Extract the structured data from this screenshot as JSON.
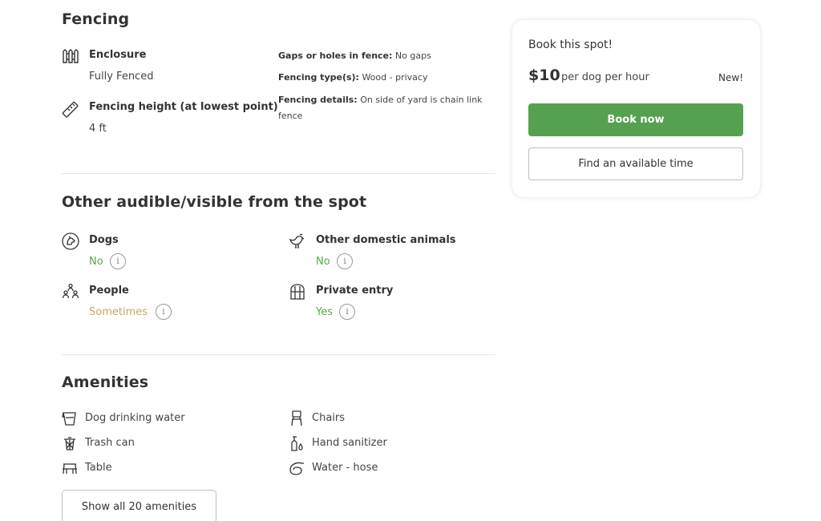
{
  "fencing": {
    "title": "Fencing",
    "enclosure": {
      "label": "Enclosure",
      "value": "Fully Fenced",
      "icon": "fence-icon"
    },
    "height": {
      "label": "Fencing height (at lowest point)",
      "value": "4 ft",
      "icon": "ruler-icon"
    },
    "details": [
      {
        "key": "Gaps or holes in fence:",
        "value": "No gaps"
      },
      {
        "key": "Fencing type(s):",
        "value": "Wood - privacy"
      },
      {
        "key": "Fencing details:",
        "value": "On side of yard is chain link fence"
      }
    ]
  },
  "audible": {
    "title": "Other audible/visible from the spot",
    "items": [
      {
        "label": "Dogs",
        "value": "No",
        "status": "green",
        "icon": "dog-icon"
      },
      {
        "label": "Other domestic animals",
        "value": "No",
        "status": "green",
        "icon": "rooster-icon"
      },
      {
        "label": "People",
        "value": "Sometimes",
        "status": "tan",
        "icon": "people-icon"
      },
      {
        "label": "Private entry",
        "value": "Yes",
        "status": "green",
        "icon": "gate-icon"
      }
    ]
  },
  "amenities": {
    "title": "Amenities",
    "items": [
      {
        "label": "Dog drinking water",
        "icon": "water-bowl-icon"
      },
      {
        "label": "Chairs",
        "icon": "chair-icon"
      },
      {
        "label": "Trash can",
        "icon": "trash-can-icon"
      },
      {
        "label": "Hand sanitizer",
        "icon": "sanitizer-icon"
      },
      {
        "label": "Table",
        "icon": "table-icon"
      },
      {
        "label": "Water - hose",
        "icon": "hose-icon"
      }
    ],
    "show_all_label": "Show all 20 amenities"
  },
  "booking": {
    "title": "Book this spot!",
    "price": "$10",
    "price_unit": "per dog per hour",
    "badge": "New!",
    "book_label": "Book now",
    "find_label": "Find an available time"
  },
  "colors": {
    "accent_green": "#56a14f",
    "status_green": "#5aa64c",
    "status_tan": "#c6a664"
  }
}
